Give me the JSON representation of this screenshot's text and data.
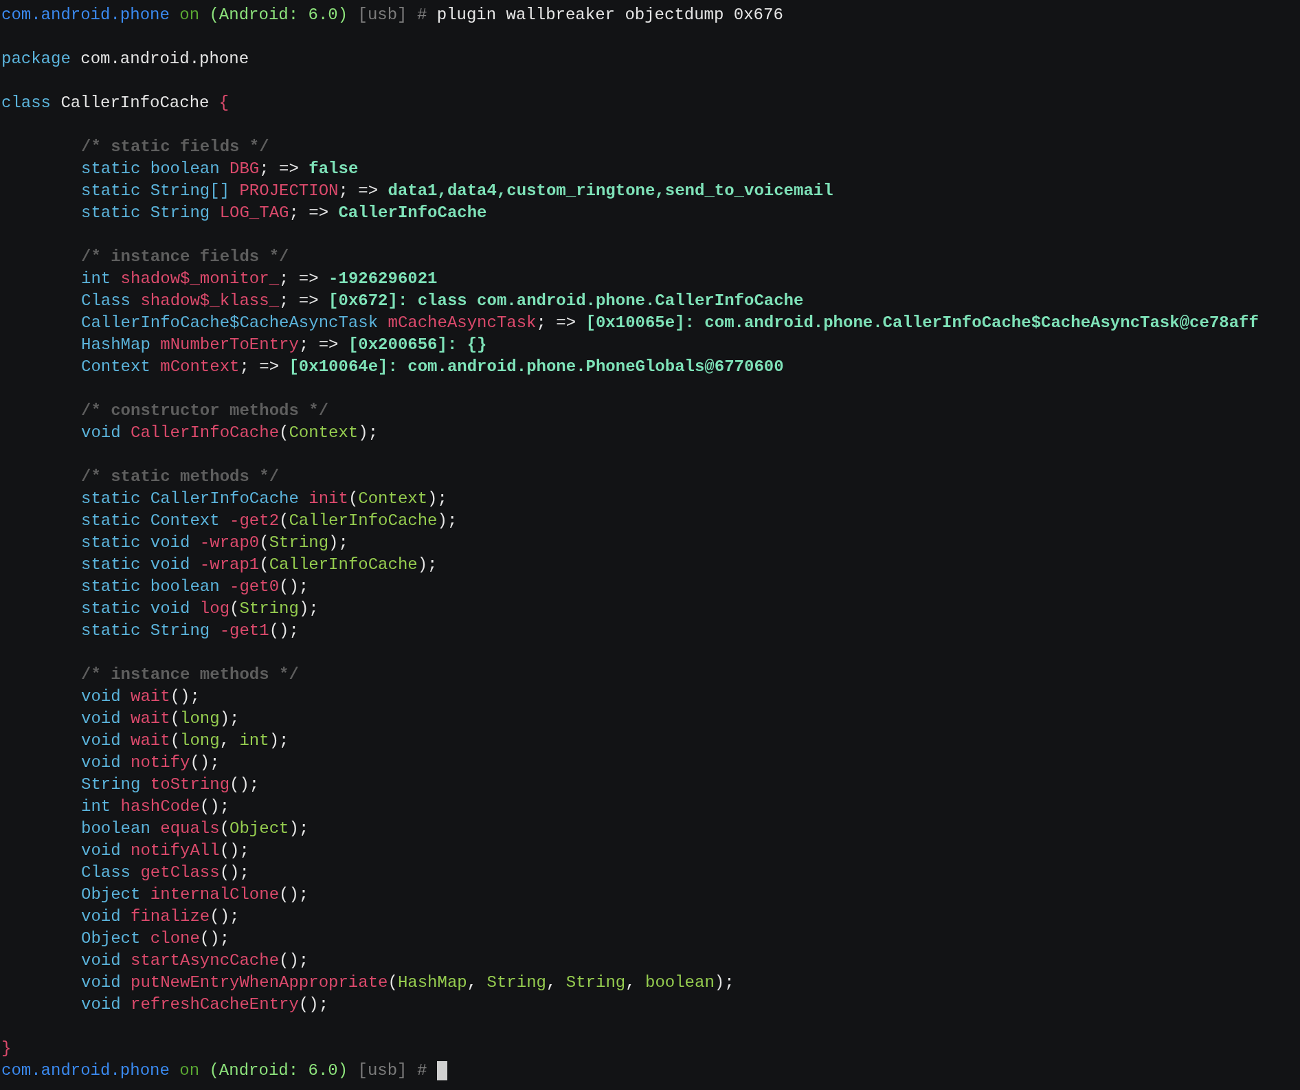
{
  "terminal": {
    "lines": [
      {
        "kind": "prompt",
        "segments": [
          {
            "kind": "host",
            "text": "com.android.phone"
          },
          {
            "kind": "on",
            "text": " on"
          },
          {
            "kind": "device",
            "text": " (Android: 6.0)"
          },
          {
            "kind": "muted",
            "text": " [usb] #"
          },
          {
            "kind": "command",
            "text": " plugin wallbreaker objectdump 0x676"
          }
        ]
      },
      {
        "kind": "blank"
      },
      {
        "kind": "code",
        "segments": [
          {
            "kind": "keyword",
            "text": "package"
          },
          {
            "kind": "plain",
            "text": " com.android.phone"
          }
        ]
      },
      {
        "kind": "blank"
      },
      {
        "kind": "code",
        "segments": [
          {
            "kind": "keyword",
            "text": "class"
          },
          {
            "kind": "plain",
            "text": " CallerInfoCache"
          },
          {
            "kind": "brace",
            "text": " {"
          }
        ],
        "children": [
          {
            "kind": "blank"
          },
          {
            "kind": "code",
            "segments": [
              {
                "kind": "comment",
                "text": "/* static fields */"
              }
            ]
          },
          {
            "kind": "code",
            "segments": [
              {
                "kind": "keyword",
                "text": "static boolean"
              },
              {
                "kind": "name",
                "text": " DBG"
              },
              {
                "kind": "plain",
                "text": "; => "
              },
              {
                "kind": "value",
                "text": "false"
              }
            ]
          },
          {
            "kind": "code",
            "segments": [
              {
                "kind": "keyword",
                "text": "static String[]"
              },
              {
                "kind": "name",
                "text": " PROJECTION"
              },
              {
                "kind": "plain",
                "text": "; => "
              },
              {
                "kind": "value",
                "text": "data1,data4,custom_ringtone,send_to_voicemail"
              }
            ]
          },
          {
            "kind": "code",
            "segments": [
              {
                "kind": "keyword",
                "text": "static String"
              },
              {
                "kind": "name",
                "text": " LOG_TAG"
              },
              {
                "kind": "plain",
                "text": "; => "
              },
              {
                "kind": "value",
                "text": "CallerInfoCache"
              }
            ]
          },
          {
            "kind": "blank"
          },
          {
            "kind": "code",
            "segments": [
              {
                "kind": "comment",
                "text": "/* instance fields */"
              }
            ]
          },
          {
            "kind": "code",
            "segments": [
              {
                "kind": "keyword",
                "text": "int"
              },
              {
                "kind": "name",
                "text": " shadow$_monitor_"
              },
              {
                "kind": "plain",
                "text": "; => "
              },
              {
                "kind": "value",
                "text": "-1926296021"
              }
            ]
          },
          {
            "kind": "code",
            "segments": [
              {
                "kind": "keyword",
                "text": "Class"
              },
              {
                "kind": "name",
                "text": " shadow$_klass_"
              },
              {
                "kind": "plain",
                "text": "; => "
              },
              {
                "kind": "value",
                "text": "[0x672]: class com.android.phone.CallerInfoCache"
              }
            ]
          },
          {
            "kind": "code",
            "segments": [
              {
                "kind": "keyword",
                "text": "CallerInfoCache$CacheAsyncTask"
              },
              {
                "kind": "name",
                "text": " mCacheAsyncTask"
              },
              {
                "kind": "plain",
                "text": "; => "
              },
              {
                "kind": "value",
                "text": "[0x10065e]: com.android.phone.CallerInfoCache$CacheAsyncTask@ce78aff"
              }
            ]
          },
          {
            "kind": "code",
            "segments": [
              {
                "kind": "keyword",
                "text": "HashMap"
              },
              {
                "kind": "name",
                "text": " mNumberToEntry"
              },
              {
                "kind": "plain",
                "text": "; => "
              },
              {
                "kind": "value",
                "text": "[0x200656]: {}"
              }
            ]
          },
          {
            "kind": "code",
            "segments": [
              {
                "kind": "keyword",
                "text": "Context"
              },
              {
                "kind": "name",
                "text": " mContext"
              },
              {
                "kind": "plain",
                "text": "; => "
              },
              {
                "kind": "value",
                "text": "[0x10064e]: com.android.phone.PhoneGlobals@6770600"
              }
            ]
          },
          {
            "kind": "blank"
          },
          {
            "kind": "code",
            "segments": [
              {
                "kind": "comment",
                "text": "/* constructor methods */"
              }
            ]
          },
          {
            "kind": "code",
            "segments": [
              {
                "kind": "keyword",
                "text": "void"
              },
              {
                "kind": "name",
                "text": " CallerInfoCache"
              },
              {
                "kind": "plain",
                "text": "("
              },
              {
                "kind": "param",
                "text": "Context"
              },
              {
                "kind": "plain",
                "text": ");"
              }
            ]
          },
          {
            "kind": "blank"
          },
          {
            "kind": "code",
            "segments": [
              {
                "kind": "comment",
                "text": "/* static methods */"
              }
            ]
          },
          {
            "kind": "code",
            "segments": [
              {
                "kind": "keyword",
                "text": "static CallerInfoCache"
              },
              {
                "kind": "name",
                "text": " init"
              },
              {
                "kind": "plain",
                "text": "("
              },
              {
                "kind": "param",
                "text": "Context"
              },
              {
                "kind": "plain",
                "text": ");"
              }
            ]
          },
          {
            "kind": "code",
            "segments": [
              {
                "kind": "keyword",
                "text": "static Context"
              },
              {
                "kind": "name",
                "text": " -get2"
              },
              {
                "kind": "plain",
                "text": "("
              },
              {
                "kind": "param",
                "text": "CallerInfoCache"
              },
              {
                "kind": "plain",
                "text": ");"
              }
            ]
          },
          {
            "kind": "code",
            "segments": [
              {
                "kind": "keyword",
                "text": "static void"
              },
              {
                "kind": "name",
                "text": " -wrap0"
              },
              {
                "kind": "plain",
                "text": "("
              },
              {
                "kind": "param",
                "text": "String"
              },
              {
                "kind": "plain",
                "text": ");"
              }
            ]
          },
          {
            "kind": "code",
            "segments": [
              {
                "kind": "keyword",
                "text": "static void"
              },
              {
                "kind": "name",
                "text": " -wrap1"
              },
              {
                "kind": "plain",
                "text": "("
              },
              {
                "kind": "param",
                "text": "CallerInfoCache"
              },
              {
                "kind": "plain",
                "text": ");"
              }
            ]
          },
          {
            "kind": "code",
            "segments": [
              {
                "kind": "keyword",
                "text": "static boolean"
              },
              {
                "kind": "name",
                "text": " -get0"
              },
              {
                "kind": "plain",
                "text": "();"
              }
            ]
          },
          {
            "kind": "code",
            "segments": [
              {
                "kind": "keyword",
                "text": "static void"
              },
              {
                "kind": "name",
                "text": " log"
              },
              {
                "kind": "plain",
                "text": "("
              },
              {
                "kind": "param",
                "text": "String"
              },
              {
                "kind": "plain",
                "text": ");"
              }
            ]
          },
          {
            "kind": "code",
            "segments": [
              {
                "kind": "keyword",
                "text": "static String"
              },
              {
                "kind": "name",
                "text": " -get1"
              },
              {
                "kind": "plain",
                "text": "();"
              }
            ]
          },
          {
            "kind": "blank"
          },
          {
            "kind": "code",
            "segments": [
              {
                "kind": "comment",
                "text": "/* instance methods */"
              }
            ]
          },
          {
            "kind": "code",
            "segments": [
              {
                "kind": "keyword",
                "text": "void"
              },
              {
                "kind": "name",
                "text": " wait"
              },
              {
                "kind": "plain",
                "text": "();"
              }
            ]
          },
          {
            "kind": "code",
            "segments": [
              {
                "kind": "keyword",
                "text": "void"
              },
              {
                "kind": "name",
                "text": " wait"
              },
              {
                "kind": "plain",
                "text": "("
              },
              {
                "kind": "param",
                "text": "long"
              },
              {
                "kind": "plain",
                "text": ");"
              }
            ]
          },
          {
            "kind": "code",
            "segments": [
              {
                "kind": "keyword",
                "text": "void"
              },
              {
                "kind": "name",
                "text": " wait"
              },
              {
                "kind": "plain",
                "text": "("
              },
              {
                "kind": "param",
                "text": "long"
              },
              {
                "kind": "plain",
                "text": ", "
              },
              {
                "kind": "param",
                "text": "int"
              },
              {
                "kind": "plain",
                "text": ");"
              }
            ]
          },
          {
            "kind": "code",
            "segments": [
              {
                "kind": "keyword",
                "text": "void"
              },
              {
                "kind": "name",
                "text": " notify"
              },
              {
                "kind": "plain",
                "text": "();"
              }
            ]
          },
          {
            "kind": "code",
            "segments": [
              {
                "kind": "keyword",
                "text": "String"
              },
              {
                "kind": "name",
                "text": " toString"
              },
              {
                "kind": "plain",
                "text": "();"
              }
            ]
          },
          {
            "kind": "code",
            "segments": [
              {
                "kind": "keyword",
                "text": "int"
              },
              {
                "kind": "name",
                "text": " hashCode"
              },
              {
                "kind": "plain",
                "text": "();"
              }
            ]
          },
          {
            "kind": "code",
            "segments": [
              {
                "kind": "keyword",
                "text": "boolean"
              },
              {
                "kind": "name",
                "text": " equals"
              },
              {
                "kind": "plain",
                "text": "("
              },
              {
                "kind": "param",
                "text": "Object"
              },
              {
                "kind": "plain",
                "text": ");"
              }
            ]
          },
          {
            "kind": "code",
            "segments": [
              {
                "kind": "keyword",
                "text": "void"
              },
              {
                "kind": "name",
                "text": " notifyAll"
              },
              {
                "kind": "plain",
                "text": "();"
              }
            ]
          },
          {
            "kind": "code",
            "segments": [
              {
                "kind": "keyword",
                "text": "Class"
              },
              {
                "kind": "name",
                "text": " getClass"
              },
              {
                "kind": "plain",
                "text": "();"
              }
            ]
          },
          {
            "kind": "code",
            "segments": [
              {
                "kind": "keyword",
                "text": "Object"
              },
              {
                "kind": "name",
                "text": " internalClone"
              },
              {
                "kind": "plain",
                "text": "();"
              }
            ]
          },
          {
            "kind": "code",
            "segments": [
              {
                "kind": "keyword",
                "text": "void"
              },
              {
                "kind": "name",
                "text": " finalize"
              },
              {
                "kind": "plain",
                "text": "();"
              }
            ]
          },
          {
            "kind": "code",
            "segments": [
              {
                "kind": "keyword",
                "text": "Object"
              },
              {
                "kind": "name",
                "text": " clone"
              },
              {
                "kind": "plain",
                "text": "();"
              }
            ]
          },
          {
            "kind": "code",
            "segments": [
              {
                "kind": "keyword",
                "text": "void"
              },
              {
                "kind": "name",
                "text": " startAsyncCache"
              },
              {
                "kind": "plain",
                "text": "();"
              }
            ]
          },
          {
            "kind": "code",
            "segments": [
              {
                "kind": "keyword",
                "text": "void"
              },
              {
                "kind": "name",
                "text": " putNewEntryWhenAppropriate"
              },
              {
                "kind": "plain",
                "text": "("
              },
              {
                "kind": "param",
                "text": "HashMap"
              },
              {
                "kind": "plain",
                "text": ", "
              },
              {
                "kind": "param",
                "text": "String"
              },
              {
                "kind": "plain",
                "text": ", "
              },
              {
                "kind": "param",
                "text": "String"
              },
              {
                "kind": "plain",
                "text": ", "
              },
              {
                "kind": "param",
                "text": "boolean"
              },
              {
                "kind": "plain",
                "text": ");"
              }
            ]
          },
          {
            "kind": "code",
            "segments": [
              {
                "kind": "keyword",
                "text": "void"
              },
              {
                "kind": "name",
                "text": " refreshCacheEntry"
              },
              {
                "kind": "plain",
                "text": "();"
              }
            ]
          },
          {
            "kind": "blank"
          }
        ]
      },
      {
        "kind": "code",
        "segments": [
          {
            "kind": "brace",
            "text": "}"
          }
        ]
      },
      {
        "kind": "prompt",
        "cursor": true,
        "segments": [
          {
            "kind": "host",
            "text": "com.android.phone"
          },
          {
            "kind": "on",
            "text": " on"
          },
          {
            "kind": "device",
            "text": " (Android: 6.0)"
          },
          {
            "kind": "muted",
            "text": " [usb] #"
          }
        ]
      }
    ]
  }
}
